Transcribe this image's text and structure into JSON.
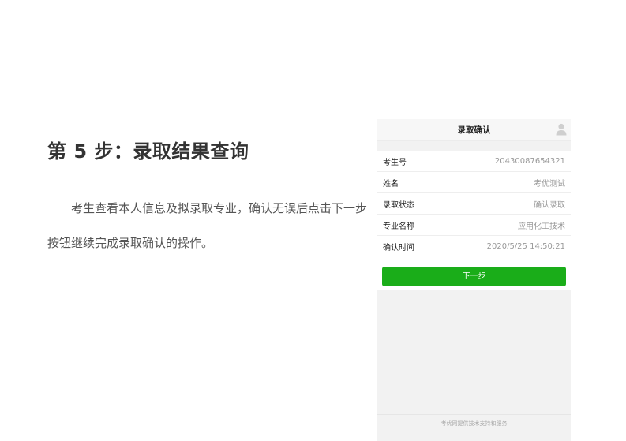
{
  "step": {
    "title": "第 5 步：录取结果查询",
    "description": "考生查看本人信息及拟录取专业，确认无误后点击下一步按钮继续完成录取确认的操作。"
  },
  "phone": {
    "header": {
      "title": "录取确认",
      "icon": "user-icon"
    },
    "rows": [
      {
        "label": "考生号",
        "value": "20430087654321"
      },
      {
        "label": "姓名",
        "value": "考优测试"
      },
      {
        "label": "录取状态",
        "value": "确认录取"
      },
      {
        "label": "专业名称",
        "value": "应用化工技术"
      },
      {
        "label": "确认时间",
        "value": "2020/5/25 14:50:21"
      }
    ],
    "next_button": "下一步",
    "footer": "考优网提供技术支持和服务"
  },
  "colors": {
    "accent": "#1aad19",
    "background": "#f2f2f2"
  }
}
